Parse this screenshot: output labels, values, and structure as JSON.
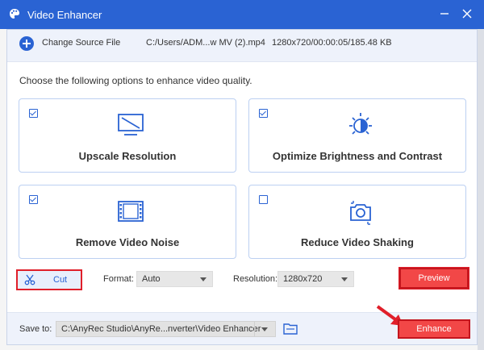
{
  "window": {
    "title": "Video Enhancer",
    "minimize_glyph": "—",
    "close_glyph": "✕"
  },
  "source": {
    "change_label": "Change Source File",
    "file_path": "C:/Users/ADM...w MV (2).mp4",
    "file_info": "1280x720/00:00:05/185.48 KB"
  },
  "instruction": "Choose the following options to enhance video quality.",
  "options": [
    {
      "label": "Upscale Resolution",
      "checked": true,
      "icon": "monitor-slash-icon"
    },
    {
      "label": "Optimize Brightness and Contrast",
      "checked": true,
      "icon": "brightness-icon"
    },
    {
      "label": "Remove Video Noise",
      "checked": true,
      "icon": "film-strip-icon"
    },
    {
      "label": "Reduce Video Shaking",
      "checked": false,
      "icon": "camera-stabilize-icon"
    }
  ],
  "controls": {
    "cut_label": "Cut",
    "format_label": "Format:",
    "format_value": "Auto",
    "resolution_label": "Resolution:",
    "resolution_value": "1280x720",
    "preview_label": "Preview"
  },
  "footer": {
    "save_label": "Save to:",
    "save_path": "C:\\AnyRec Studio\\AnyRe...nverter\\Video Enhancer",
    "enhance_label": "Enhance"
  },
  "colors": {
    "accent": "#2a63d3",
    "highlight": "#e01f2a"
  }
}
